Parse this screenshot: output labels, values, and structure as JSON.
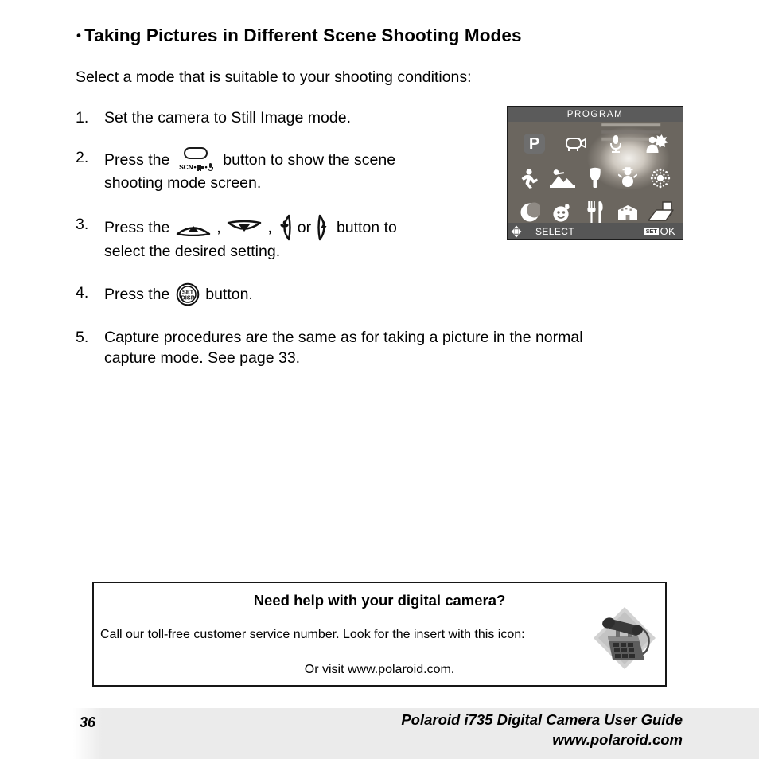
{
  "page": {
    "heading_bullet": "•",
    "heading": "Taking Pictures in Different Scene Shooting Modes",
    "intro": "Select a mode that is suitable to your shooting conditions:"
  },
  "steps": [
    {
      "number": "1.",
      "line1": "Set the camera to Still Image mode.",
      "line2": ""
    },
    {
      "number": "2.",
      "pre": "Press the",
      "icon": "scn-mode-button-icon",
      "post": "button to show the scene",
      "line2": "shooting mode screen."
    },
    {
      "number": "3.",
      "pre": "Press the",
      "icons": [
        "up-arrow-button-icon",
        "down-arrow-button-icon",
        "left-macro-button-icon",
        "right-flash-button-icon"
      ],
      "sep1": ",",
      "sep2": ",",
      "or": "or",
      "post": "button to",
      "line2": "select the desired setting."
    },
    {
      "number": "4.",
      "pre": "Press the",
      "icon": "set-disp-button-icon",
      "post": "button.",
      "line2": ""
    },
    {
      "number": "5.",
      "line1": "Capture procedures are the same as for taking a picture in the normal",
      "line2": "capture mode. See page 33."
    }
  ],
  "lcd": {
    "title": "PROGRAM",
    "selected_mode": "P",
    "modes": [
      [
        {
          "name": "program-mode-icon",
          "label": "P",
          "selected": true
        },
        {
          "name": "video-mode-icon",
          "label": "",
          "selected": false
        },
        {
          "name": "voice-recording-mode-icon",
          "label": "",
          "selected": false
        },
        {
          "name": "portrait-mode-icon",
          "label": "",
          "selected": false
        }
      ],
      [
        {
          "name": "sports-mode-icon",
          "label": "",
          "selected": false
        },
        {
          "name": "landscape-mode-icon",
          "label": "",
          "selected": false
        },
        {
          "name": "sunset-mode-icon",
          "label": "",
          "selected": false
        },
        {
          "name": "snow-mode-icon",
          "label": "",
          "selected": false
        },
        {
          "name": "fireworks-mode-icon",
          "label": "",
          "selected": false
        }
      ],
      [
        {
          "name": "night-scene-mode-icon",
          "label": "",
          "selected": false
        },
        {
          "name": "children-mode-icon",
          "label": "",
          "selected": false
        },
        {
          "name": "food-mode-icon",
          "label": "",
          "selected": false
        },
        {
          "name": "building-mode-icon",
          "label": "",
          "selected": false
        },
        {
          "name": "text-mode-icon",
          "label": "",
          "selected": false
        }
      ]
    ],
    "footer": {
      "nav_icon": "four-way-nav-icon",
      "select_label": "SELECT",
      "set_chip": "SET",
      "ok_label": "OK"
    },
    "colors": {
      "title_bar": "#5b5b5b",
      "bottom_bar": "#565656",
      "selected_badge": "#6e6e6e",
      "border": "#1b1b1b"
    }
  },
  "help_box": {
    "title": "Need help with your digital camera?",
    "line1": "Call our toll-free customer service number. Look for the insert with this icon:",
    "line2": "Or visit www.polaroid.com.",
    "icon": "telephone-icon"
  },
  "footer": {
    "page_number": "36",
    "line1": "Polaroid i735 Digital Camera User Guide",
    "line2": "www.polaroid.com",
    "band_color": "#ebebeb"
  }
}
